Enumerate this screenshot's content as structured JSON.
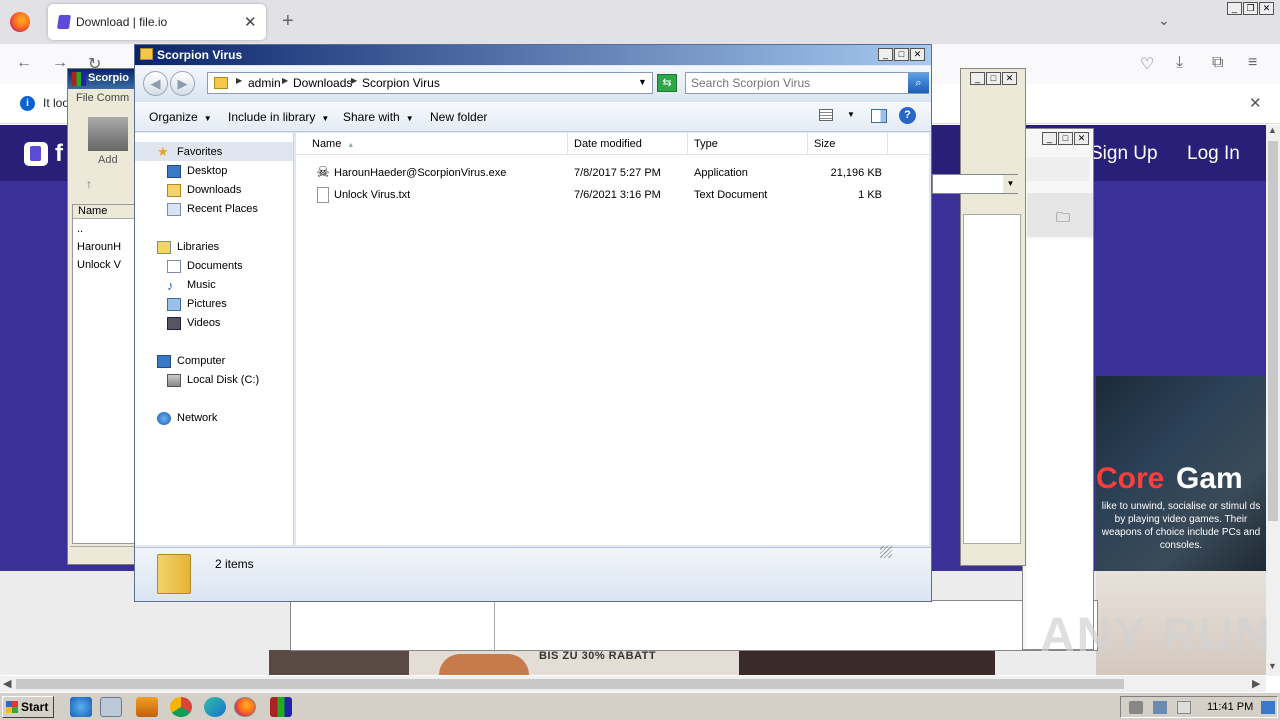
{
  "browser": {
    "tab_title": "Download | file.io",
    "notification_text": "It loo",
    "site": {
      "logo_letter": "f",
      "signup": "Sign Up",
      "login": "Log In",
      "ad_word1": "Core",
      "ad_word2": "Gam",
      "ad_text": "like to unwind, socialise or stimul ds by playing video games. Their weapons of choice include PCs and consoles.",
      "banner_text": "BIS ZU 30% RABATT"
    }
  },
  "winrar": {
    "title": "Scorpio",
    "menu": "File   Comm",
    "add_label": "Add",
    "list_header": "Name",
    "rows": [
      "..",
      "HarounH",
      "Unlock V"
    ]
  },
  "explorer": {
    "title": "Scorpion Virus",
    "breadcrumb": [
      "admin",
      "Downloads",
      "Scorpion Virus"
    ],
    "search_placeholder": "Search Scorpion Virus",
    "toolbar": {
      "organize": "Organize",
      "include_in_library": "Include in library",
      "share_with": "Share with",
      "new_folder": "New folder"
    },
    "nav": {
      "favorites": "Favorites",
      "desktop": "Desktop",
      "downloads": "Downloads",
      "recent_places": "Recent Places",
      "libraries": "Libraries",
      "documents": "Documents",
      "music": "Music",
      "pictures": "Pictures",
      "videos": "Videos",
      "computer": "Computer",
      "local_disk": "Local Disk (C:)",
      "network": "Network"
    },
    "columns": {
      "name": "Name",
      "date_modified": "Date modified",
      "type": "Type",
      "size": "Size"
    },
    "files": [
      {
        "name": "HarounHaeder@ScorpionVirus.exe",
        "date": "7/8/2017 5:27 PM",
        "type": "Application",
        "size": "21,196 KB",
        "icon": "skull-icon"
      },
      {
        "name": "Unlock Virus.txt",
        "date": "7/6/2021 3:16 PM",
        "type": "Text Document",
        "size": "1 KB",
        "icon": "text-file-icon"
      }
    ],
    "status": "2 items"
  },
  "taskbar": {
    "start": "Start",
    "clock": "11:41 PM"
  },
  "watermark": "ANY RUN"
}
